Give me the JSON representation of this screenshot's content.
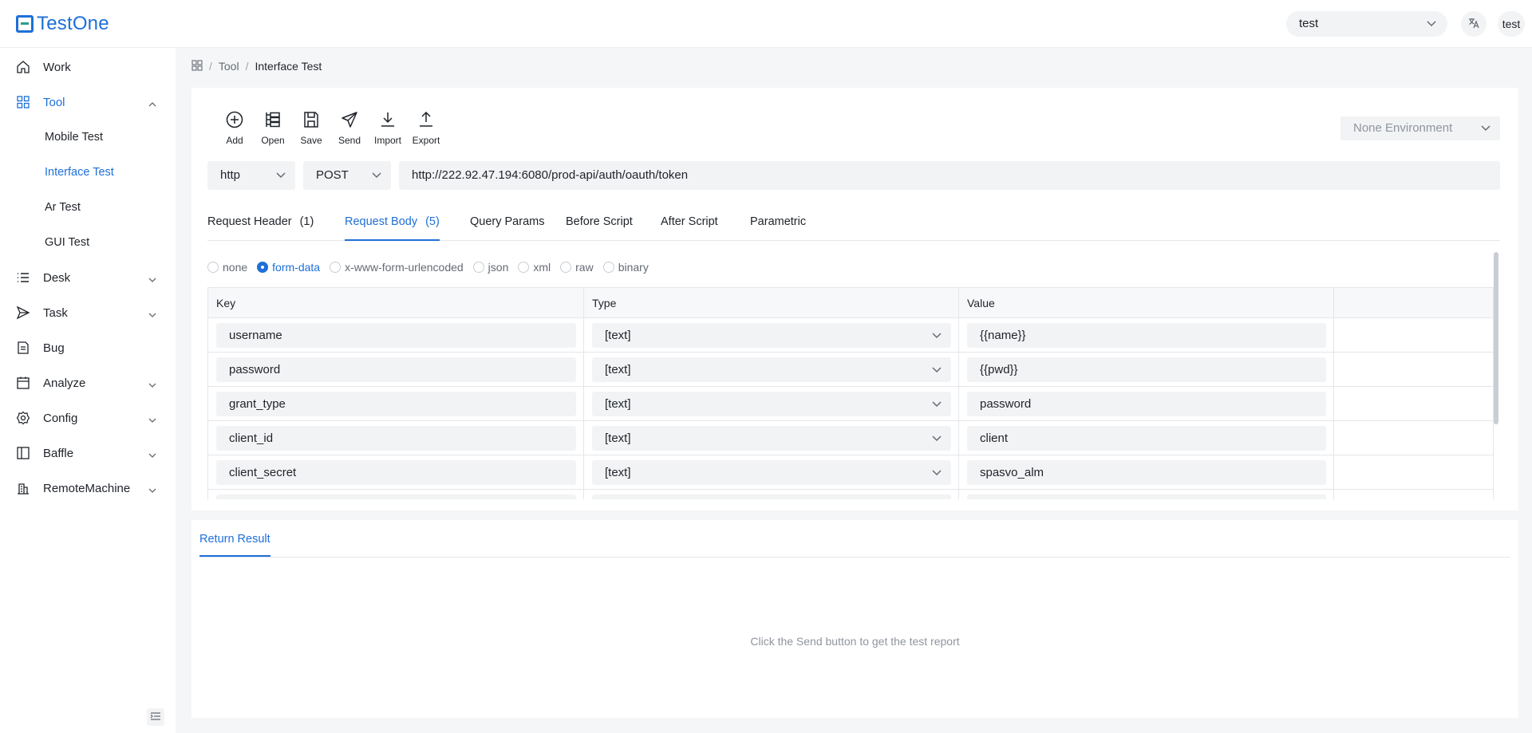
{
  "app": {
    "name": "TestOne"
  },
  "header": {
    "project": "test",
    "user": "test",
    "lang_icon": "translate-icon"
  },
  "sidebar": {
    "items": [
      {
        "label": "Work",
        "icon": "home-icon"
      },
      {
        "label": "Tool",
        "icon": "grid-icon",
        "expanded": true
      },
      {
        "label": "Desk",
        "icon": "list-icon"
      },
      {
        "label": "Task",
        "icon": "send-icon"
      },
      {
        "label": "Bug",
        "icon": "document-icon"
      },
      {
        "label": "Analyze",
        "icon": "calendar-icon"
      },
      {
        "label": "Config",
        "icon": "gear-icon"
      },
      {
        "label": "Baffle",
        "icon": "layout-icon"
      },
      {
        "label": "RemoteMachine",
        "icon": "server-icon"
      }
    ],
    "tool_children": [
      "Mobile Test",
      "Interface Test",
      "Ar Test",
      "GUI Test"
    ]
  },
  "breadcrumb": {
    "parent": "Tool",
    "current": "Interface Test"
  },
  "toolbar": {
    "add": "Add",
    "open": "Open",
    "save": "Save",
    "send": "Send",
    "import": "Import",
    "export": "Export"
  },
  "environment": {
    "value": "None Environment"
  },
  "request": {
    "protocol": "http",
    "method": "POST",
    "url": "http://222.92.47.194:6080/prod-api/auth/oauth/token"
  },
  "tabs": [
    {
      "label": "Request Header",
      "count": "(1)"
    },
    {
      "label": "Request Body",
      "count": "(5)"
    },
    {
      "label": "Query Params"
    },
    {
      "label": "Before Script"
    },
    {
      "label": "After Script"
    },
    {
      "label": "Parametric"
    }
  ],
  "body_types": [
    "none",
    "form-data",
    "x-www-form-urlencoded",
    "json",
    "xml",
    "raw",
    "binary"
  ],
  "body_type_selected": "form-data",
  "table": {
    "headers": [
      "Key",
      "Type",
      "Value"
    ],
    "rows": [
      {
        "key": "username",
        "type": "[text]",
        "value": "{{name}}"
      },
      {
        "key": "password",
        "type": "[text]",
        "value": "{{pwd}}"
      },
      {
        "key": "grant_type",
        "type": "[text]",
        "value": "password"
      },
      {
        "key": "client_id",
        "type": "[text]",
        "value": "client"
      },
      {
        "key": "client_secret",
        "type": "[text]",
        "value": "spasvo_alm"
      }
    ]
  },
  "result": {
    "tab": "Return Result",
    "empty_text": "Click the Send button to get the test report"
  },
  "colors": {
    "accent": "#1e6fd9",
    "input_bg": "#f2f3f5",
    "page_bg": "#f5f6f7"
  }
}
